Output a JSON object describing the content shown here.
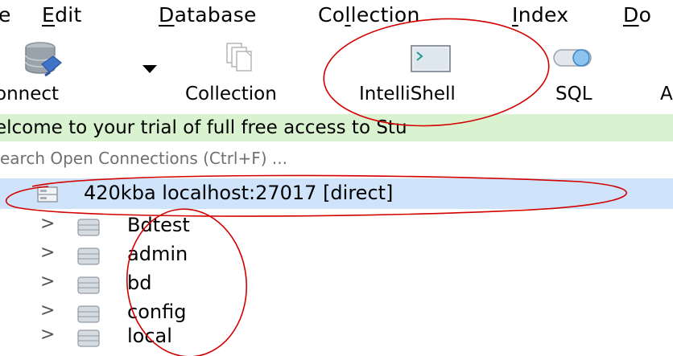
{
  "menubar": {
    "items": [
      {
        "text": "e",
        "mnemonic": "",
        "rest": ""
      },
      {
        "text": "",
        "mnemonic": "E",
        "rest": "dit"
      },
      {
        "text": "",
        "mnemonic": "D",
        "rest": "atabase"
      },
      {
        "text": "Co",
        "mnemonic": "l",
        "rest": "lection"
      },
      {
        "text": "",
        "mnemonic": "I",
        "rest": "ndex"
      },
      {
        "text": "",
        "mnemonic": "D",
        "rest": "o"
      }
    ]
  },
  "toolbar": {
    "connect_label": "onnect",
    "collection_label": "Collection",
    "intellishell_label": "IntelliShell",
    "sql_label": "SQL",
    "extra_label": "A"
  },
  "banner": {
    "text": "elcome to your trial of full free access to Stu"
  },
  "search": {
    "placeholder": "earch Open Connections (Ctrl+F) ..."
  },
  "tree": {
    "connection_label": "420kba localhost:27017 [direct]",
    "databases": [
      "Bdtest",
      "admin",
      "bd",
      "config",
      "local"
    ]
  },
  "colors": {
    "banner_bg": "#d9f2d0",
    "selected_row_bg": "#cfe4fb",
    "annotation": "#d40000"
  },
  "icons": {
    "connect": "database-connect-icon",
    "collection": "collection-icon",
    "intellishell": "shell-terminal-icon",
    "sql": "sql-toggle-icon",
    "dropdown": "dropdown-arrow-icon",
    "server": "server-icon",
    "database": "database-icon",
    "expand": "chevron-right-icon"
  }
}
